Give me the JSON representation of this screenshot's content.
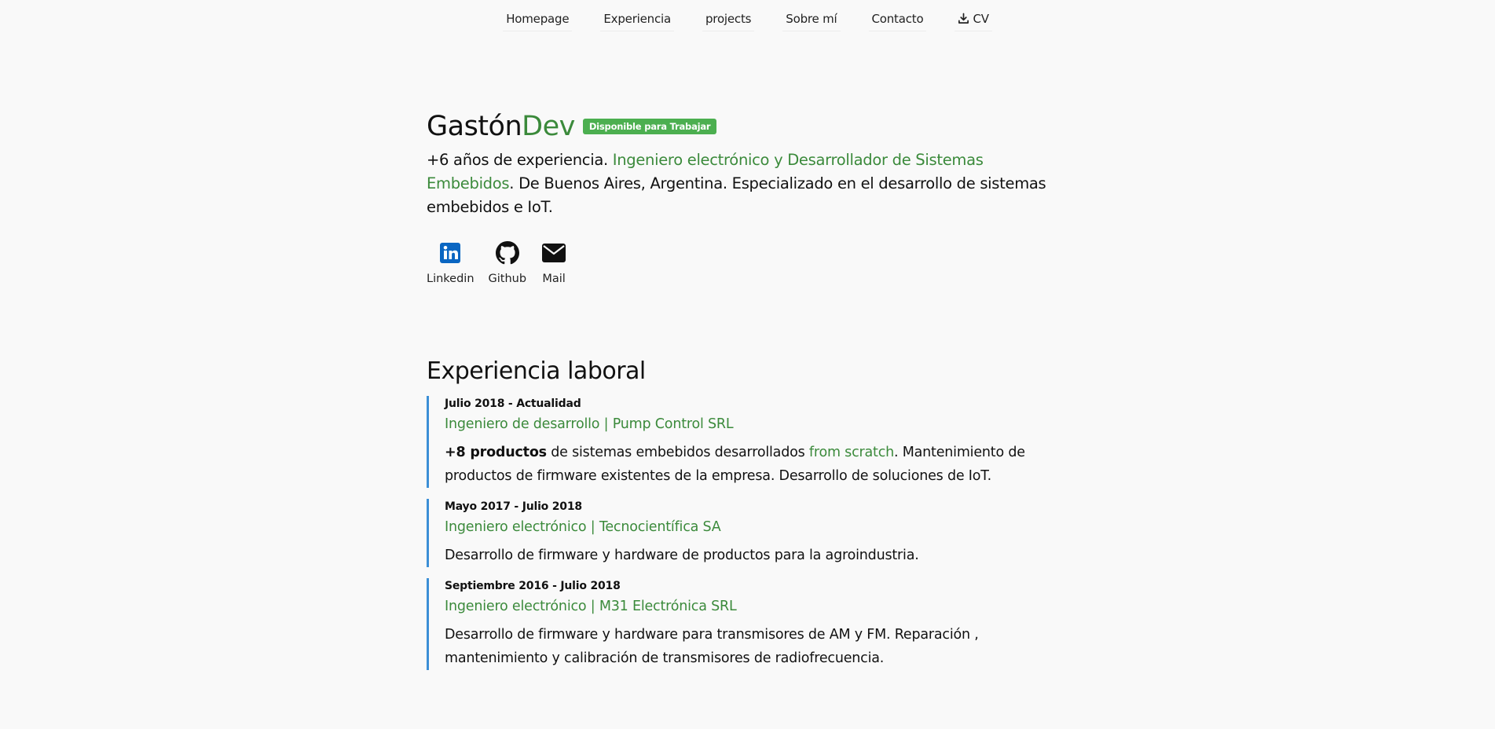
{
  "nav": {
    "items": [
      "Homepage",
      "Experiencia",
      "projects",
      "Sobre mí",
      "Contacto"
    ],
    "cv_label": "CV"
  },
  "hero": {
    "name_main": "Gastón",
    "name_accent": "Dev",
    "badge": "Disponible para Trabajar",
    "desc_1": "+6 años de experiencia. ",
    "desc_highlight": "Ingeniero electrónico y Desarrollador de Sistemas Embebidos",
    "desc_2": ". De Buenos Aires, Argentina. Especializado en el desarrollo de sistemas embebidos e IoT."
  },
  "socials": [
    {
      "label": "Linkedin",
      "icon": "linkedin-icon"
    },
    {
      "label": "Github",
      "icon": "github-icon"
    },
    {
      "label": "Mail",
      "icon": "mail-icon"
    }
  ],
  "experience": {
    "title": "Experiencia laboral",
    "jobs": [
      {
        "date": "Julio 2018 - Actualidad",
        "role": "Ingeniero de desarrollo | Pump Control SRL",
        "desc_bold": "+8 productos",
        "desc_1": " de sistemas embebidos desarrollados ",
        "desc_highlight": "from scratch",
        "desc_2": ". Mantenimiento de productos de firmware existentes de la empresa. Desarrollo de soluciones de IoT."
      },
      {
        "date": "Mayo 2017 - Julio 2018",
        "role": "Ingeniero electrónico | Tecnocientífica SA",
        "desc": "Desarrollo de firmware y hardware de productos para la agroindustria."
      },
      {
        "date": "Septiembre 2016 - Julio 2018",
        "role": "Ingeniero electrónico | M31 Electrónica SRL",
        "desc": "Desarrollo de firmware y hardware para transmisores de AM y FM. Reparación , mantenimiento y calibración de transmisores de radiofrecuencia."
      }
    ]
  },
  "colors": {
    "accent_green": "#3b8a3b",
    "badge_green": "#4caf50",
    "timeline_blue": "#3c8fd6",
    "linkedin_blue": "#0a66c2"
  }
}
